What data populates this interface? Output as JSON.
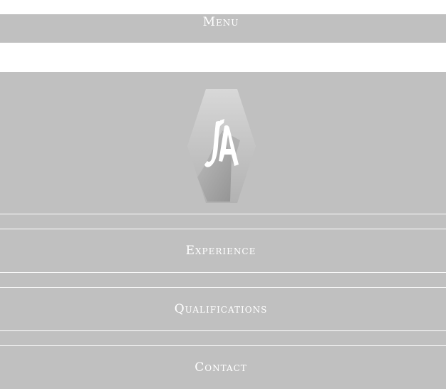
{
  "header": {
    "menu_label": "Menu"
  },
  "logo": {
    "initials": "JA"
  },
  "nav": {
    "items": [
      {
        "label": "Experience"
      },
      {
        "label": "Qualifications"
      },
      {
        "label": "Contact"
      }
    ]
  },
  "colors": {
    "panel": "#c0c0c0",
    "text": "#ffffff",
    "background": "#ffffff"
  }
}
